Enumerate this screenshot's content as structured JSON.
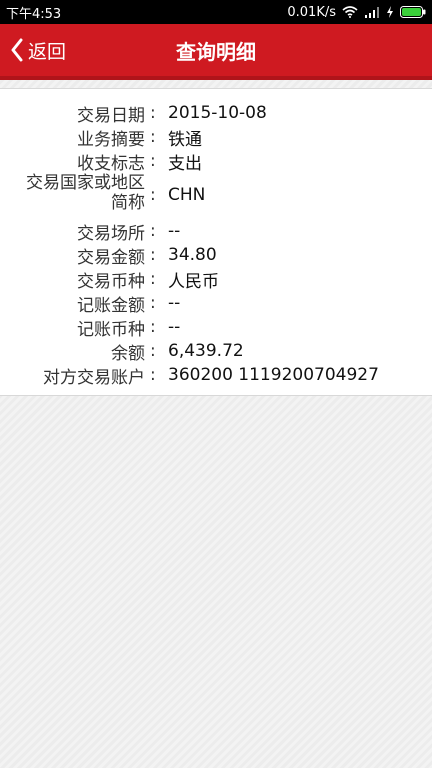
{
  "status_bar": {
    "time": "下午4:53",
    "net_speed": "0.01K/s"
  },
  "header": {
    "back_label": "返回",
    "title": "查询明细"
  },
  "details": [
    {
      "label": "交易日期",
      "value": "2015-10-08"
    },
    {
      "label": "业务摘要",
      "value": "铁通"
    },
    {
      "label": "收支标志",
      "value": "支出"
    },
    {
      "label_line1": "交易国家或地区",
      "label_line2": "简称",
      "value": "CHN"
    },
    {
      "label": "交易场所",
      "value": "--"
    },
    {
      "label": "交易金额",
      "value": "34.80"
    },
    {
      "label": "交易币种",
      "value": "人民币"
    },
    {
      "label": "记账金额",
      "value": "--"
    },
    {
      "label": "记账币种",
      "value": "--"
    },
    {
      "label": "余额",
      "value": "6,439.72"
    },
    {
      "label": "对方交易账户",
      "value": "360200 1119200704927"
    }
  ],
  "colors": {
    "brand_red": "#cf1a21"
  }
}
